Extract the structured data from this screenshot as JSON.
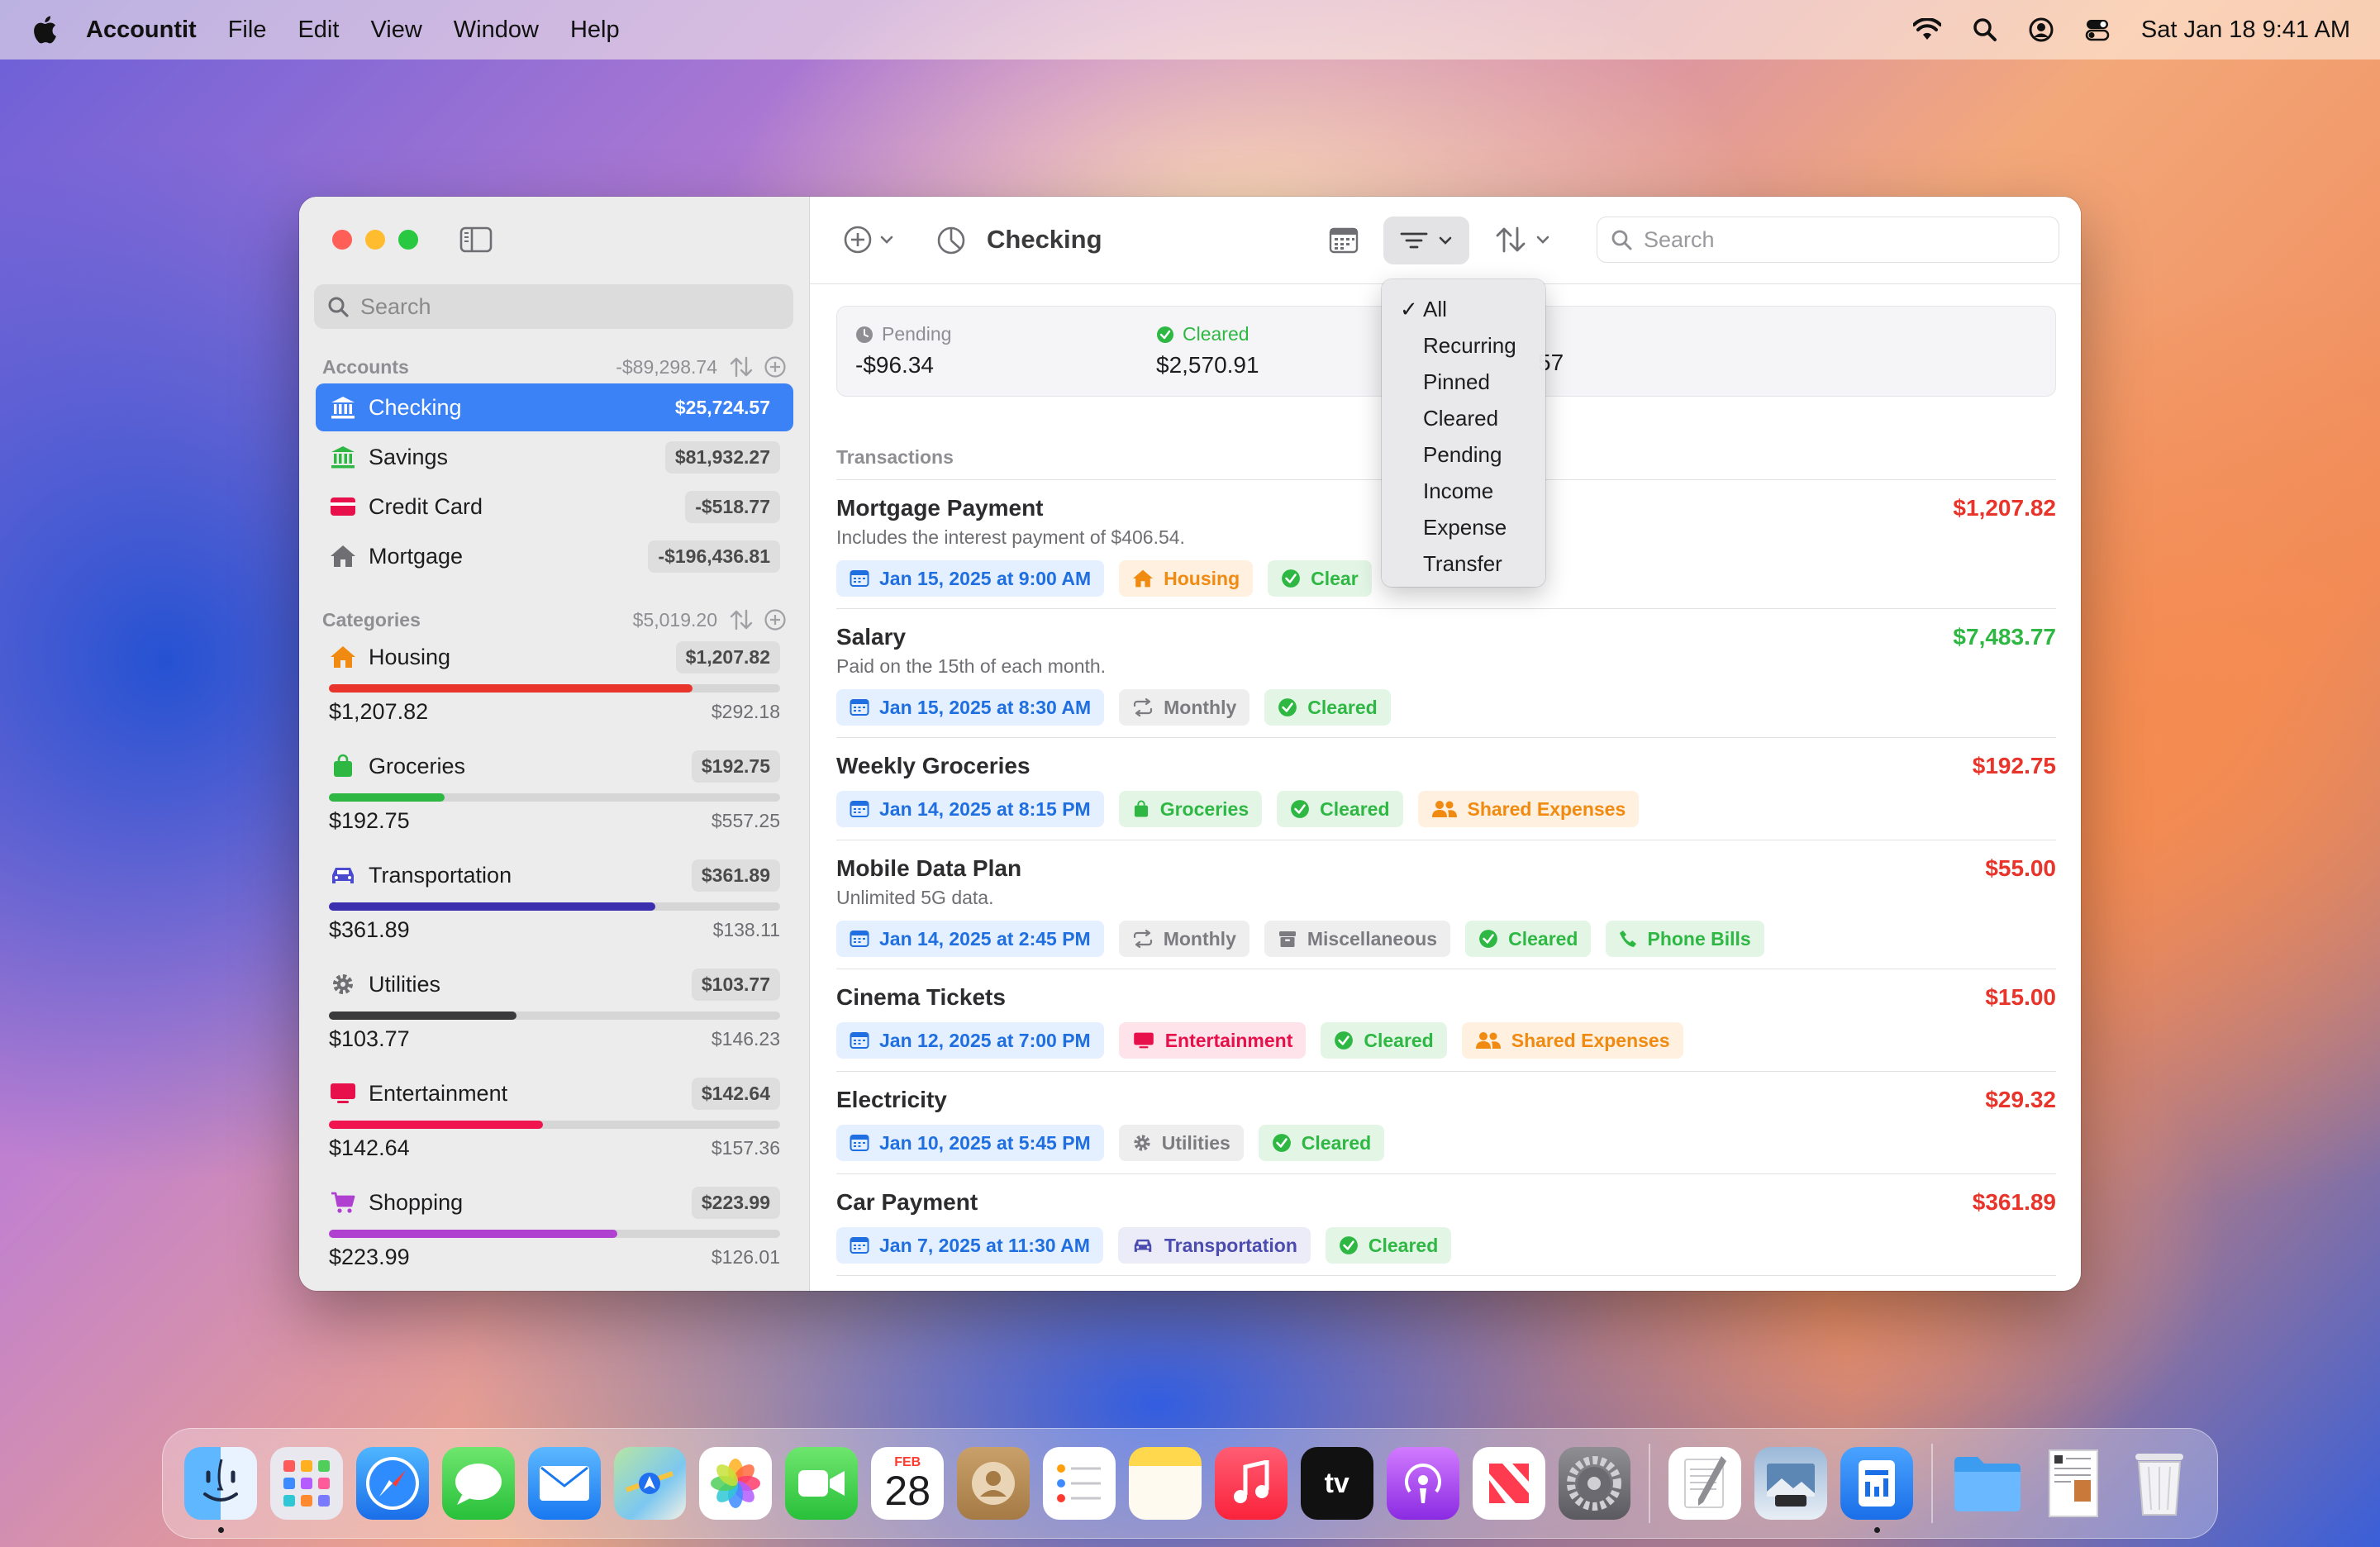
{
  "menubar": {
    "app_name": "Accountit",
    "menus": [
      "File",
      "Edit",
      "View",
      "Window",
      "Help"
    ],
    "clock": "Sat Jan 18  9:41 AM",
    "icons": [
      "apple-logo",
      "wifi-icon",
      "search-icon",
      "user-icon",
      "control-center-icon"
    ]
  },
  "sidebar": {
    "search_placeholder": "Search",
    "accounts_header": "Accounts",
    "accounts_total": "-$89,298.74",
    "accounts": [
      {
        "label": "Checking",
        "balance": "$25,724.57",
        "icon": "bank-icon",
        "color": "#ffffff",
        "selected": true
      },
      {
        "label": "Savings",
        "balance": "$81,932.27",
        "icon": "bank-icon",
        "color": "#2eb843"
      },
      {
        "label": "Credit Card",
        "balance": "-$518.77",
        "icon": "credit-card-icon",
        "color": "#e8104a"
      },
      {
        "label": "Mortgage",
        "balance": "-$196,436.81",
        "icon": "house-icon",
        "color": "#6e6e73"
      }
    ],
    "categories_header": "Categories",
    "categories_total": "$5,019.20",
    "categories": [
      {
        "label": "Housing",
        "badge": "$1,207.82",
        "spent": "$1,207.82",
        "remaining": "$292.18",
        "progress": 0.805,
        "color": "#e8342a",
        "icon": "house-icon",
        "icon_color": "#f08a10"
      },
      {
        "label": "Groceries",
        "badge": "$192.75",
        "spent": "$192.75",
        "remaining": "$557.25",
        "progress": 0.257,
        "color": "#2eb843",
        "icon": "shopping-bag-icon",
        "icon_color": "#2eb843"
      },
      {
        "label": "Transportation",
        "badge": "$361.89",
        "spent": "$361.89",
        "remaining": "$138.11",
        "progress": 0.724,
        "color": "#3b2fb0",
        "icon": "car-icon",
        "icon_color": "#4b4bd0"
      },
      {
        "label": "Utilities",
        "badge": "$103.77",
        "spent": "$103.77",
        "remaining": "$146.23",
        "progress": 0.415,
        "color": "#3a3a3c",
        "icon": "gear-icon",
        "icon_color": "#6e6e73"
      },
      {
        "label": "Entertainment",
        "badge": "$142.64",
        "spent": "$142.64",
        "remaining": "$157.36",
        "progress": 0.475,
        "color": "#f0154f",
        "icon": "tv-icon",
        "icon_color": "#e8104a"
      },
      {
        "label": "Shopping",
        "badge": "$223.99",
        "spent": "$223.99",
        "remaining": "$126.01",
        "progress": 0.64,
        "color": "#b040d0",
        "icon": "cart-icon",
        "icon_color": "#b040d0"
      }
    ]
  },
  "toolbar": {
    "title": "Checking",
    "search_placeholder": "Search"
  },
  "summary": {
    "pending_label": "Pending",
    "pending_value": "-$96.34",
    "cleared_label": "Cleared",
    "cleared_value": "$2,570.91",
    "partial_value": "57"
  },
  "transactions_header": "Transactions",
  "transactions": [
    {
      "title": "Mortgage Payment",
      "note": "Includes the interest payment of $406.54.",
      "amount": "$1,207.82",
      "amount_color": "#e8342a",
      "tags": [
        {
          "kind": "date",
          "text": "Jan 15, 2025 at 9:00 AM"
        },
        {
          "kind": "housing",
          "text": "Housing"
        },
        {
          "kind": "cleared",
          "text": "Clear"
        }
      ]
    },
    {
      "title": "Salary",
      "note": "Paid on the 15th of each month.",
      "amount": "$7,483.77",
      "amount_color": "#2eb843",
      "tags": [
        {
          "kind": "date",
          "text": "Jan 15, 2025 at 8:30 AM"
        },
        {
          "kind": "monthly",
          "text": "Monthly"
        },
        {
          "kind": "cleared",
          "text": "Cleared"
        }
      ]
    },
    {
      "title": "Weekly Groceries",
      "note": "",
      "amount": "$192.75",
      "amount_color": "#e8342a",
      "tags": [
        {
          "kind": "date",
          "text": "Jan 14, 2025 at 8:15 PM"
        },
        {
          "kind": "groceries",
          "text": "Groceries"
        },
        {
          "kind": "cleared",
          "text": "Cleared"
        },
        {
          "kind": "shared",
          "text": "Shared Expenses"
        }
      ]
    },
    {
      "title": "Mobile Data Plan",
      "note": "Unlimited 5G data.",
      "amount": "$55.00",
      "amount_color": "#e8342a",
      "tags": [
        {
          "kind": "date",
          "text": "Jan 14, 2025 at 2:45 PM"
        },
        {
          "kind": "monthly",
          "text": "Monthly"
        },
        {
          "kind": "misc",
          "text": "Miscellaneous"
        },
        {
          "kind": "cleared",
          "text": "Cleared"
        },
        {
          "kind": "phone",
          "text": "Phone Bills"
        }
      ]
    },
    {
      "title": "Cinema Tickets",
      "note": "",
      "amount": "$15.00",
      "amount_color": "#e8342a",
      "tags": [
        {
          "kind": "date",
          "text": "Jan 12, 2025 at 7:00 PM"
        },
        {
          "kind": "ent",
          "text": "Entertainment"
        },
        {
          "kind": "cleared",
          "text": "Cleared"
        },
        {
          "kind": "shared",
          "text": "Shared Expenses"
        }
      ]
    },
    {
      "title": "Electricity",
      "note": "",
      "amount": "$29.32",
      "amount_color": "#e8342a",
      "tags": [
        {
          "kind": "date",
          "text": "Jan 10, 2025 at 5:45 PM"
        },
        {
          "kind": "utilities",
          "text": "Utilities"
        },
        {
          "kind": "cleared",
          "text": "Cleared"
        }
      ]
    },
    {
      "title": "Car Payment",
      "note": "",
      "amount": "$361.89",
      "amount_color": "#e8342a",
      "tags": [
        {
          "kind": "date",
          "text": "Jan 7, 2025 at 11:30 AM"
        },
        {
          "kind": "transport",
          "text": "Transportation"
        },
        {
          "kind": "cleared",
          "text": "Cleared"
        }
      ]
    }
  ],
  "filter_menu": {
    "selected": "All",
    "items": [
      "All",
      "Recurring",
      "Pinned",
      "Cleared",
      "Pending",
      "Income",
      "Expense",
      "Transfer"
    ]
  },
  "dock": {
    "calendar_month": "FEB",
    "calendar_day": "28",
    "apps": [
      "finder-icon",
      "launchpad-icon",
      "safari-icon",
      "messages-icon",
      "mail-icon",
      "maps-icon",
      "photos-icon",
      "facetime-icon",
      "calendar-icon",
      "contacts-icon",
      "reminders-icon",
      "notes-icon",
      "music-icon",
      "tv-app-icon",
      "podcasts-icon",
      "news-icon",
      "system-settings-icon",
      "textedit-icon",
      "preview-icon",
      "accountit-icon",
      "folder-icon",
      "document-icon",
      "trash-icon"
    ]
  }
}
